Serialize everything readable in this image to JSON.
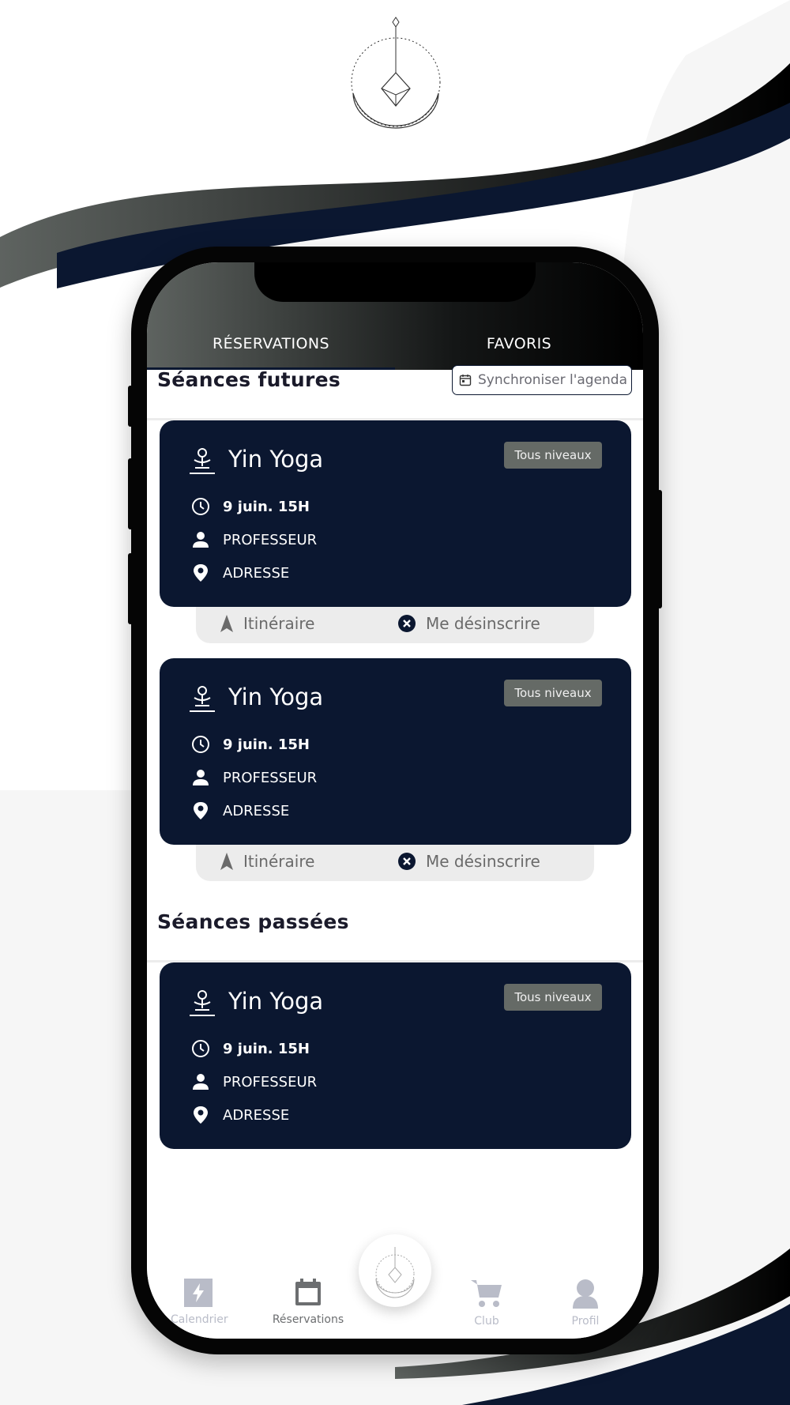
{
  "tabs": [
    {
      "label": "RÉSERVATIONS",
      "active": true
    },
    {
      "label": "FAVORIS",
      "active": false
    }
  ],
  "future": {
    "title": "Séances futures",
    "sync_label": "Synchroniser l'agenda"
  },
  "past": {
    "title": "Séances passées"
  },
  "sessions": [
    {
      "title": "Yin Yoga",
      "level": "Tous niveaux",
      "date": "9 juin. 15H",
      "teacher": "PROFESSEUR",
      "address": "ADRESSE"
    },
    {
      "title": "Yin Yoga",
      "level": "Tous niveaux",
      "date": "9 juin. 15H",
      "teacher": "PROFESSEUR",
      "address": "ADRESSE"
    },
    {
      "title": "Yin Yoga",
      "level": "Tous niveaux",
      "date": "9 juin. 15H",
      "teacher": "PROFESSEUR",
      "address": "ADRESSE"
    }
  ],
  "actions": {
    "itinerary": "Itinéraire",
    "unsubscribe": "Me désinscrire"
  },
  "nav": {
    "calendar": "Calendrier",
    "reservations": "Réservations",
    "club": "Club",
    "profile": "Profil"
  },
  "colors": {
    "navy": "#0b1730",
    "badge": "#656a66",
    "nav_icon": "#b9bcc8"
  },
  "icons": {
    "yoga": "meditation-icon",
    "clock": "clock-icon",
    "person": "person-icon",
    "pin": "location-pin-icon",
    "itinerary": "navigation-arrow-icon",
    "cancel": "close-circle-icon",
    "calendar": "calendar-icon"
  }
}
